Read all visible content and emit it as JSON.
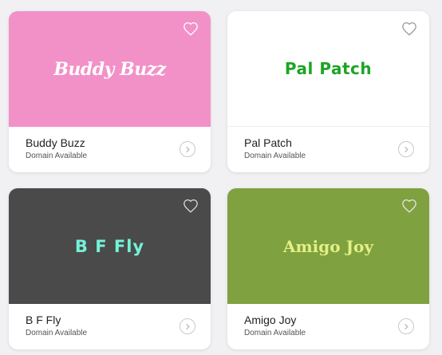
{
  "cards": [
    {
      "logo_text": "Buddy Buzz",
      "name": "Buddy Buzz",
      "status": "Domain Available",
      "banner_color": "#f291c8",
      "heart_color": "#ffffff"
    },
    {
      "logo_text": "Pal Patch",
      "name": "Pal Patch",
      "status": "Domain Available",
      "banner_color": "#ffffff",
      "heart_color": "#9a9a9a"
    },
    {
      "logo_text": "B F Fly",
      "name": "B F Fly",
      "status": "Domain Available",
      "banner_color": "#4a4a4a",
      "heart_color": "#d9d9d9"
    },
    {
      "logo_text": "Amigo Joy",
      "name": "Amigo Joy",
      "status": "Domain Available",
      "banner_color": "#7fa140",
      "heart_color": "#e6e6e6"
    }
  ],
  "icons": {
    "favorite": "heart-outline-icon",
    "open": "chevron-right-circle-icon"
  }
}
